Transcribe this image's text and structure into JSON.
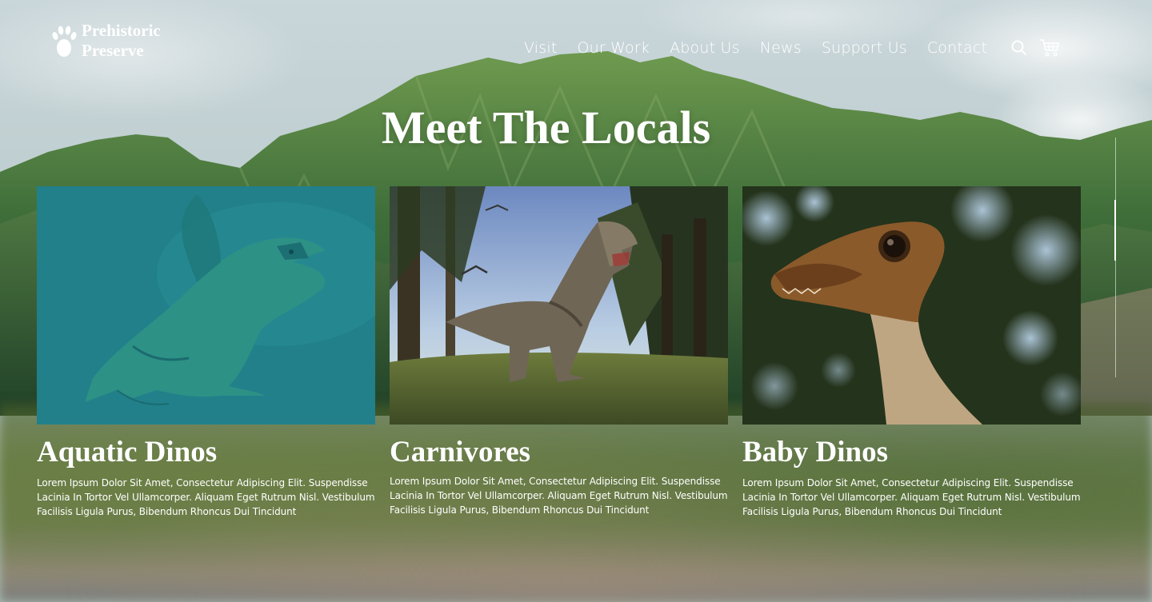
{
  "brand": {
    "line1": "Prehistoric",
    "line2": "Preserve",
    "icon": "footprint-icon"
  },
  "nav": {
    "items": [
      {
        "label": "Visit"
      },
      {
        "label": "Our Work"
      },
      {
        "label": "About Us"
      },
      {
        "label": "News"
      },
      {
        "label": "Support Us"
      },
      {
        "label": "Contact"
      }
    ],
    "search_icon": "search-icon",
    "cart_icon": "cart-icon"
  },
  "hero": {
    "title": "Meet The Locals"
  },
  "cards": [
    {
      "title": "Aquatic Dinos",
      "text": "Lorem Ipsum Dolor Sit Amet, Consectetur Adipiscing Elit. Suspendisse Lacinia In Tortor Vel Ullamcorper. Aliquam Eget Rutrum Nisl. Vestibulum Facilisis Ligula Purus, Bibendum Rhoncus Dui Tincidunt",
      "image": "aquatic-dino-photo"
    },
    {
      "title": "Carnivores",
      "text": "Lorem Ipsum Dolor Sit Amet, Consectetur Adipiscing Elit. Suspendisse Lacinia In Tortor Vel Ullamcorper. Aliquam Eget Rutrum Nisl. Vestibulum Facilisis Ligula Purus, Bibendum Rhoncus Dui Tincidunt",
      "image": "trex-photo"
    },
    {
      "title": "Baby Dinos",
      "text": "Lorem Ipsum Dolor Sit Amet, Consectetur Adipiscing Elit. Suspendisse Lacinia In Tortor Vel Ullamcorper. Aliquam Eget Rutrum Nisl. Vestibulum Facilisis Ligula Purus, Bibendum Rhoncus Dui Tincidunt",
      "image": "baby-dino-photo"
    }
  ],
  "colors": {
    "accent_teal": "#21808a",
    "text": "#ffffff"
  }
}
